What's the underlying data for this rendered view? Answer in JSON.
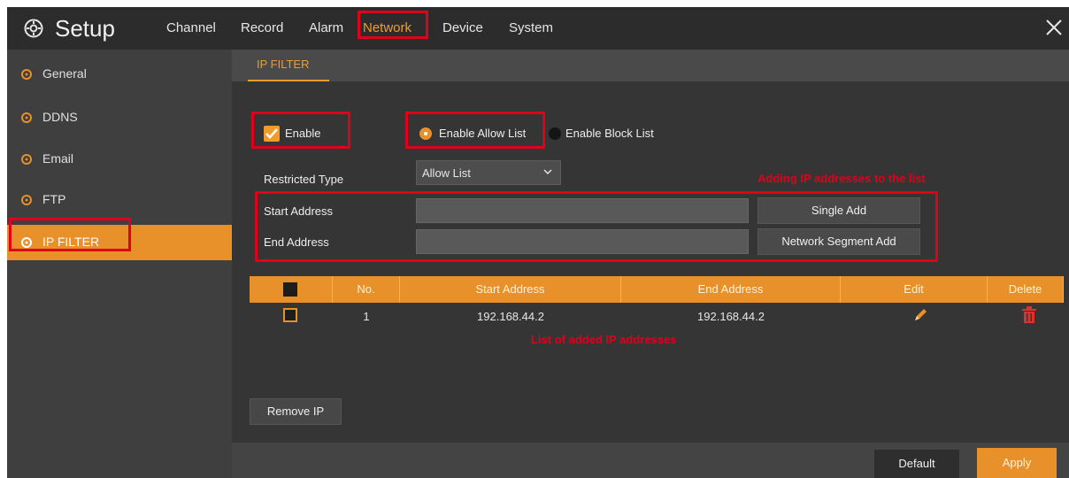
{
  "app": {
    "title": "Setup"
  },
  "menu": {
    "items": [
      {
        "label": "Channel"
      },
      {
        "label": "Record"
      },
      {
        "label": "Alarm"
      },
      {
        "label": "Network"
      },
      {
        "label": "Device"
      },
      {
        "label": "System"
      }
    ],
    "active": "Network"
  },
  "sidebar": {
    "items": [
      {
        "label": "General"
      },
      {
        "label": "DDNS"
      },
      {
        "label": "Email"
      },
      {
        "label": "FTP"
      },
      {
        "label": "IP FILTER"
      }
    ],
    "active": "IP FILTER"
  },
  "tab": {
    "label": "IP FILTER"
  },
  "form": {
    "enable_label": "Enable",
    "enable_checked": true,
    "radio_allow_label": "Enable Allow List",
    "radio_block_label": "Enable Block List",
    "radio_selected": "Enable Allow List",
    "restricted_type_label": "Restricted Type",
    "restricted_type_value": "Allow List",
    "start_address_label": "Start Address",
    "start_address_value": "",
    "end_address_label": "End Address",
    "end_address_value": "",
    "single_add_label": "Single Add",
    "segment_add_label": "Network Segment Add"
  },
  "annotations": {
    "adding_note": "Adding IP addresses to the list",
    "list_note": "List of added IP addresses"
  },
  "table": {
    "columns": [
      "No.",
      "Start Address",
      "End Address",
      "Edit",
      "Delete"
    ],
    "rows": [
      {
        "no": "1",
        "start": "192.168.44.2",
        "end": "192.168.44.2"
      }
    ]
  },
  "buttons": {
    "remove_ip": "Remove IP",
    "default": "Default",
    "apply": "Apply"
  },
  "colors": {
    "accent": "#e8902a",
    "annotation": "#e1001a"
  },
  "icons": {
    "gear": "gear-icon",
    "close": "close-icon",
    "edit": "pencil-icon",
    "delete": "trash-icon"
  }
}
